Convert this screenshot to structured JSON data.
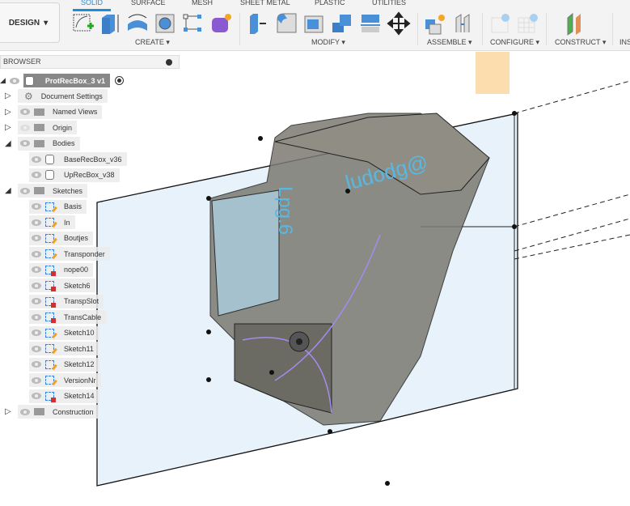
{
  "toolbar": {
    "design_label": "DESIGN",
    "tabs": [
      "SOLID",
      "SURFACE",
      "MESH",
      "SHEET METAL",
      "PLASTIC",
      "UTILITIES"
    ],
    "active_tab": "SOLID",
    "groups": {
      "create": "CREATE ▾",
      "modify": "MODIFY ▾",
      "assemble": "ASSEMBLE ▾",
      "configure": "CONFIGURE ▾",
      "construct": "CONSTRUCT ▾",
      "insert": "INS"
    },
    "accent": "#1d8ed6"
  },
  "browser": {
    "title": "BROWSER",
    "root": "ProtRecBox_3 v1",
    "items": [
      {
        "label": "Document Settings",
        "icon": "gear-icon"
      },
      {
        "label": "Named Views",
        "icon": "folder-icon"
      },
      {
        "label": "Origin",
        "icon": "folder-icon"
      },
      {
        "label": "Bodies",
        "icon": "folder-icon"
      },
      {
        "label": "BaseRecBox_v36",
        "icon": "body-icon"
      },
      {
        "label": "UpRecBox_v38",
        "icon": "body-icon"
      },
      {
        "label": "Sketches",
        "icon": "folder-icon"
      },
      {
        "label": "Basis",
        "icon": "sketch-icon"
      },
      {
        "label": "In",
        "icon": "sketch-icon"
      },
      {
        "label": "Boutjes",
        "icon": "sketch-icon"
      },
      {
        "label": "Transponder",
        "icon": "sketch-icon"
      },
      {
        "label": "nope00",
        "icon": "sketch-locked-icon"
      },
      {
        "label": "Sketch6",
        "icon": "sketch-locked-icon"
      },
      {
        "label": "TranspSlot",
        "icon": "sketch-locked-icon"
      },
      {
        "label": "TransCable",
        "icon": "sketch-locked-icon"
      },
      {
        "label": "Sketch10",
        "icon": "sketch-icon"
      },
      {
        "label": "Sketch11",
        "icon": "sketch-icon"
      },
      {
        "label": "Sketch12",
        "icon": "sketch-icon"
      },
      {
        "label": "VersionNr",
        "icon": "sketch-icon"
      },
      {
        "label": "Sketch14",
        "icon": "sketch-locked-icon"
      },
      {
        "label": "Construction",
        "icon": "folder-icon"
      }
    ]
  },
  "viewport": {
    "emboss_text_1": "ludodg@",
    "emboss_text_2": "Lpg.6"
  }
}
